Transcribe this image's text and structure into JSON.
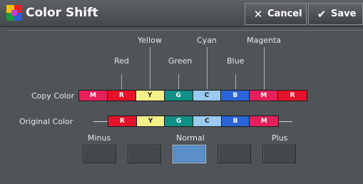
{
  "header": {
    "title": "Color Shift",
    "cancel_label": "Cancel",
    "save_label": "Save",
    "cancel_icon": "x-icon",
    "save_icon": "check-icon"
  },
  "hue_labels": {
    "upper": [
      "Yellow",
      "Cyan",
      "Magenta"
    ],
    "lower": [
      "Red",
      "Green",
      "Blue"
    ]
  },
  "copy_color": {
    "label": "Copy Color",
    "cells": [
      "M",
      "R",
      "Y",
      "G",
      "C",
      "B",
      "M",
      "R"
    ]
  },
  "original_color": {
    "label": "Original Color",
    "cells": [
      "R",
      "Y",
      "G",
      "C",
      "B",
      "M"
    ]
  },
  "shift": {
    "minus_label": "Minus",
    "normal_label": "Normal",
    "plus_label": "Plus",
    "levels": 5,
    "selected_level": 3
  },
  "colors": {
    "M": "#e6205a",
    "R": "#e4122a",
    "Y": "#f5ef8a",
    "G": "#0f8f86",
    "C": "#9bc9f0",
    "B": "#2a64d8",
    "selected_button": "#5b90c9",
    "panel": "#4f5458"
  }
}
